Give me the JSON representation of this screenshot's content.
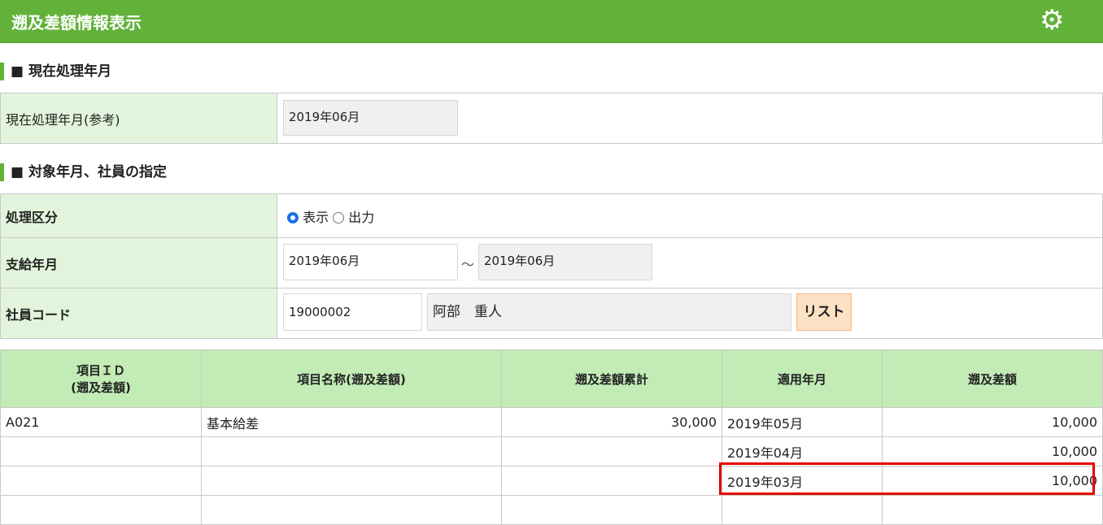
{
  "header": {
    "title": "遡及差額情報表示",
    "settings_icon": "gear-icon"
  },
  "section1": {
    "title": "■ 現在処理年月",
    "label": "現在処理年月(参考)",
    "value": "2019年06月"
  },
  "section2": {
    "title": "■ 対象年月、社員の指定",
    "processing_label": "処理区分",
    "radio_display": "表示",
    "radio_output": "出力",
    "selected": "表示",
    "payment_label": "支給年月",
    "payment_from": "2019年06月",
    "tilde": "～",
    "payment_to": "2019年06月",
    "employee_label": "社員コード",
    "employee_code": "19000002",
    "employee_name": "阿部　重人",
    "list_button": "リスト"
  },
  "table": {
    "headers": [
      "項目ＩＤ\n(遡及差額)",
      "項目名称(遡及差額)",
      "遡及差額累計",
      "適用年月",
      "遡及差額"
    ],
    "rows": [
      [
        "A021",
        "基本給差",
        "30,000",
        "2019年05月",
        "10,000"
      ],
      [
        "",
        "",
        "",
        "2019年04月",
        "10,000"
      ],
      [
        "",
        "",
        "",
        "2019年03月",
        "10,000"
      ],
      [
        "",
        "",
        "",
        "",
        ""
      ]
    ]
  }
}
